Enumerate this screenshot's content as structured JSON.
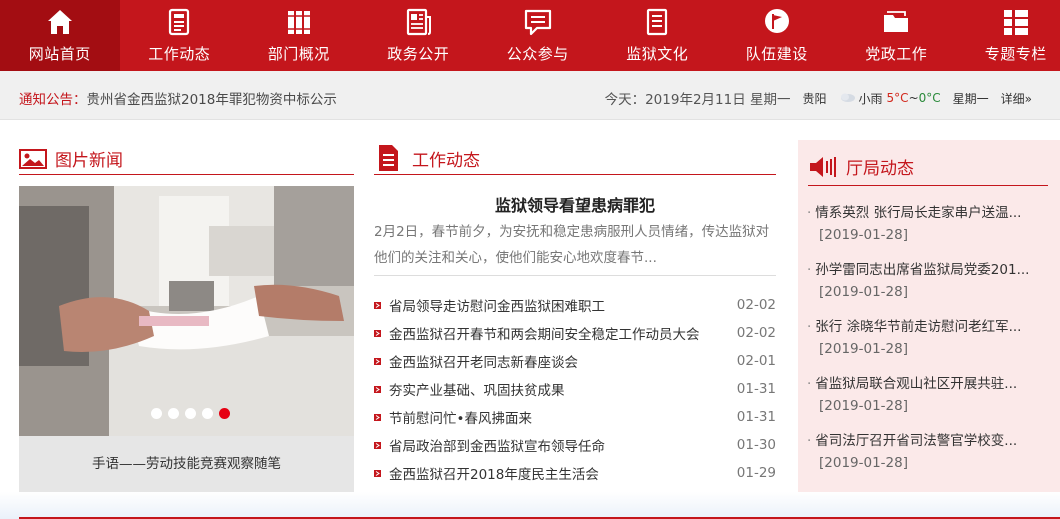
{
  "nav": {
    "items": [
      {
        "label": "网站首页",
        "icon": "home-icon",
        "active": true
      },
      {
        "label": "工作动态",
        "icon": "news-document-icon"
      },
      {
        "label": "部门概况",
        "icon": "books-icon"
      },
      {
        "label": "政务公开",
        "icon": "newspaper-icon"
      },
      {
        "label": "公众参与",
        "icon": "chat-bubble-icon"
      },
      {
        "label": "监狱文化",
        "icon": "document-list-icon"
      },
      {
        "label": "队伍建设",
        "icon": "flag-badge-icon"
      },
      {
        "label": "党政工作",
        "icon": "folder-icon"
      },
      {
        "label": "专题专栏",
        "icon": "grid-list-icon"
      }
    ]
  },
  "notice": {
    "tag": "通知公告：",
    "text": "贵州省金西监狱2018年罪犯物资中标公示",
    "today": "今天：2019年2月11日 星期一",
    "city": "贵阳",
    "weather": "小雨",
    "temp_high": "5°C",
    "temp_sep": "~",
    "temp_low": "0°C",
    "weekday": "星期一",
    "detail": "详细»"
  },
  "photo_news": {
    "heading": "图片新闻",
    "caption": "手语——劳动技能竞赛观察随笔",
    "slides": 5,
    "active_slide": 5
  },
  "work_news": {
    "heading": "工作动态",
    "feature_title": "监狱领导看望患病罪犯",
    "feature_summary": "2月2日，春节前夕，为安抚和稳定患病服刑人员情绪，传达监狱对他们的关注和关心，使他们能安心地欢度春节...",
    "items": [
      {
        "title": "省局领导走访慰问金西监狱困难职工",
        "date": "02-02"
      },
      {
        "title": "金西监狱召开春节和两会期间安全稳定工作动员大会",
        "date": "02-02"
      },
      {
        "title": "金西监狱召开老同志新春座谈会",
        "date": "02-01"
      },
      {
        "title": "夯实产业基础、巩固扶贫成果",
        "date": "01-31"
      },
      {
        "title": "节前慰问忙•春风拂面来",
        "date": "01-31"
      },
      {
        "title": "省局政治部到金西监狱宣布领导任命",
        "date": "01-30"
      },
      {
        "title": "金西监狱召开2018年度民主生活会",
        "date": "01-29"
      }
    ]
  },
  "bureau_news": {
    "heading": "厅局动态",
    "items": [
      {
        "title": "情系英烈 张行局长走家串户送温...",
        "date": "[2019-01-28]"
      },
      {
        "title": "孙学雷同志出席省监狱局党委201...",
        "date": "[2019-01-28]"
      },
      {
        "title": "张行 涂晓华节前走访慰问老红军...",
        "date": "[2019-01-28]"
      },
      {
        "title": "省监狱局联合观山社区开展共驻...",
        "date": "[2019-01-28]"
      },
      {
        "title": "省司法厅召开省司法警官学校变...",
        "date": "[2019-01-28]"
      }
    ]
  },
  "colors": {
    "brand_red": "#c4161c",
    "nav_active": "#a30d12",
    "dot_active": "#e60012",
    "bureau_bg": "#fbe9e9"
  }
}
